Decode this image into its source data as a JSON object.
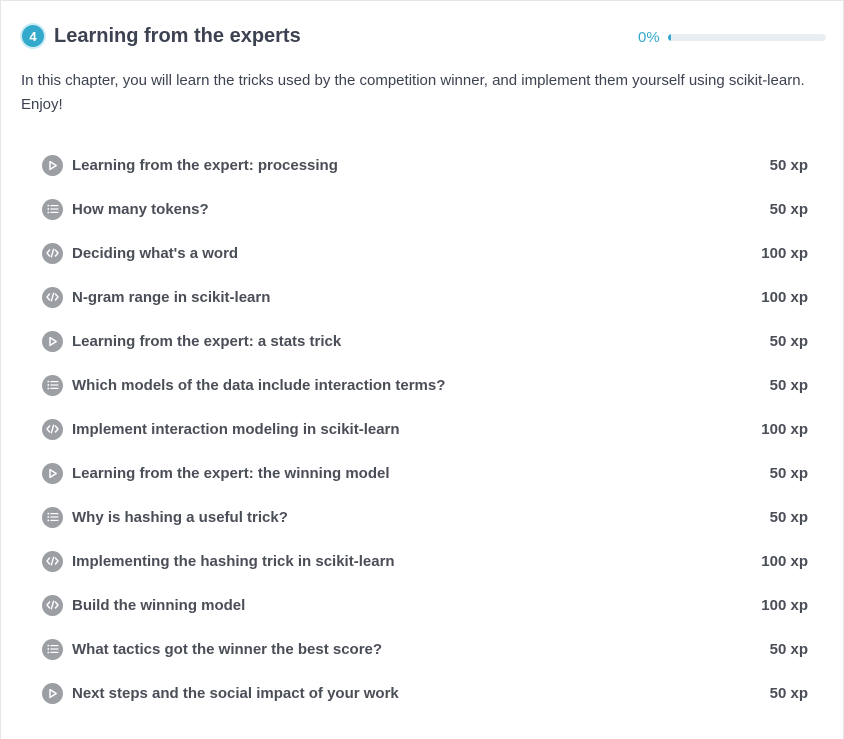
{
  "chapter": {
    "number": "4",
    "title": "Learning from the experts",
    "progress_label": "0%",
    "progress_value": 0.01,
    "accent_color": "#33aacc",
    "description": "In this chapter, you will learn the tricks used by the competition winner, and implement them yourself using scikit-learn. Enjoy!"
  },
  "exercises": [
    {
      "type": "video",
      "icon": "play-icon",
      "title": "Learning from the expert: processing",
      "xp": "50 xp"
    },
    {
      "type": "mcq",
      "icon": "list-icon",
      "title": "How many tokens?",
      "xp": "50 xp"
    },
    {
      "type": "code",
      "icon": "code-icon",
      "title": "Deciding what's a word",
      "xp": "100 xp"
    },
    {
      "type": "code",
      "icon": "code-icon",
      "title": "N-gram range in scikit-learn",
      "xp": "100 xp"
    },
    {
      "type": "video",
      "icon": "play-icon",
      "title": "Learning from the expert: a stats trick",
      "xp": "50 xp"
    },
    {
      "type": "mcq",
      "icon": "list-icon",
      "title": "Which models of the data include interaction terms?",
      "xp": "50 xp"
    },
    {
      "type": "code",
      "icon": "code-icon",
      "title": "Implement interaction modeling in scikit-learn",
      "xp": "100 xp"
    },
    {
      "type": "video",
      "icon": "play-icon",
      "title": "Learning from the expert: the winning model",
      "xp": "50 xp"
    },
    {
      "type": "mcq",
      "icon": "list-icon",
      "title": "Why is hashing a useful trick?",
      "xp": "50 xp"
    },
    {
      "type": "code",
      "icon": "code-icon",
      "title": "Implementing the hashing trick in scikit-learn",
      "xp": "100 xp"
    },
    {
      "type": "code",
      "icon": "code-icon",
      "title": "Build the winning model",
      "xp": "100 xp"
    },
    {
      "type": "mcq",
      "icon": "list-icon",
      "title": "What tactics got the winner the best score?",
      "xp": "50 xp"
    },
    {
      "type": "video",
      "icon": "play-icon",
      "title": "Next steps and the social impact of your work",
      "xp": "50 xp"
    }
  ]
}
